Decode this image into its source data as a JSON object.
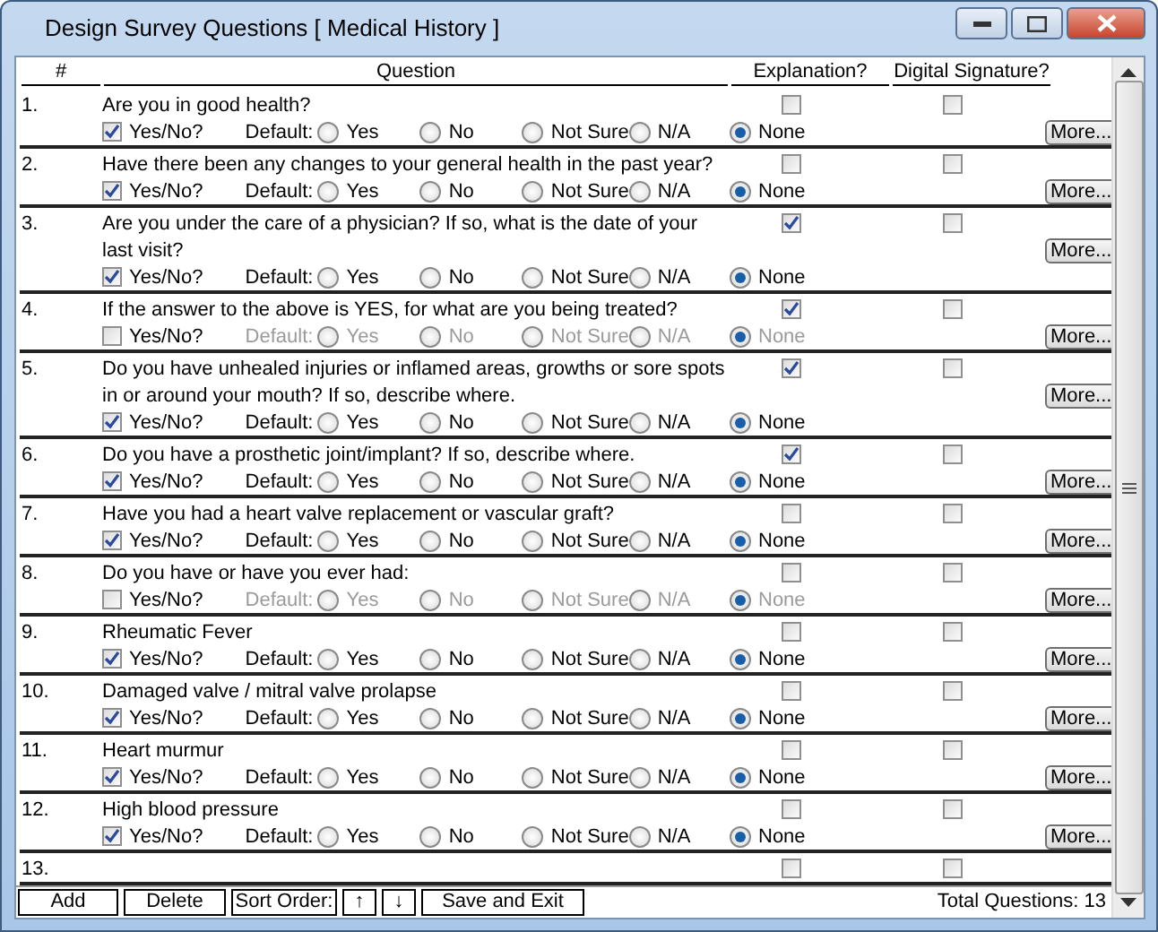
{
  "window": {
    "title": "Design Survey Questions [ Medical History ]"
  },
  "columns": [
    "#",
    "Question",
    "Explanation?",
    "Digital Signature?"
  ],
  "rows": [
    {
      "number": "1.",
      "question_lines": [
        "Are you in good health?"
      ],
      "explanation": false,
      "signature": false,
      "yes_no": {
        "label": "Yes/No?",
        "checked": true
      },
      "default_label": "Default:",
      "options": [
        {
          "label": "Yes",
          "selected": false
        },
        {
          "label": "No",
          "selected": false
        },
        {
          "label": "Not Sure",
          "selected": false
        },
        {
          "label": "N/A",
          "selected": false
        },
        {
          "label": "None",
          "selected": true
        }
      ],
      "more": "More..."
    },
    {
      "number": "2.",
      "question_lines": [
        "Have there been any changes to your general health in the past year?"
      ],
      "explanation": false,
      "signature": false,
      "yes_no": {
        "label": "Yes/No?",
        "checked": true
      },
      "default_label": "Default:",
      "options": [
        {
          "label": "Yes",
          "selected": false
        },
        {
          "label": "No",
          "selected": false
        },
        {
          "label": "Not Sure",
          "selected": false
        },
        {
          "label": "N/A",
          "selected": false
        },
        {
          "label": "None",
          "selected": true
        }
      ],
      "more": "More..."
    },
    {
      "number": "3.",
      "question_lines": [
        "Are you under the care of a physician? If so, what is the date of your",
        "last visit?"
      ],
      "explanation": true,
      "signature": false,
      "yes_no": {
        "label": "Yes/No?",
        "checked": true
      },
      "default_label": "Default:",
      "options": [
        {
          "label": "Yes",
          "selected": false
        },
        {
          "label": "No",
          "selected": false
        },
        {
          "label": "Not Sure",
          "selected": false
        },
        {
          "label": "N/A",
          "selected": false
        },
        {
          "label": "None",
          "selected": true
        }
      ],
      "more": "More..."
    },
    {
      "number": "4.",
      "question_lines": [
        "If the answer to the above is YES, for what are you being treated?"
      ],
      "explanation": true,
      "signature": false,
      "yes_no": {
        "label": "Yes/No?",
        "checked": false
      },
      "default_label": "Default:",
      "options": [
        {
          "label": "Yes",
          "selected": false
        },
        {
          "label": "No",
          "selected": false
        },
        {
          "label": "Not Sure",
          "selected": false
        },
        {
          "label": "N/A",
          "selected": false
        },
        {
          "label": "None",
          "selected": true
        }
      ],
      "more": "More..."
    },
    {
      "number": "5.",
      "question_lines": [
        "Do you have unhealed injuries or inflamed areas, growths or sore spots",
        "in or around your mouth? If so, describe where."
      ],
      "explanation": true,
      "signature": false,
      "yes_no": {
        "label": "Yes/No?",
        "checked": true
      },
      "default_label": "Default:",
      "options": [
        {
          "label": "Yes",
          "selected": false
        },
        {
          "label": "No",
          "selected": false
        },
        {
          "label": "Not Sure",
          "selected": false
        },
        {
          "label": "N/A",
          "selected": false
        },
        {
          "label": "None",
          "selected": true
        }
      ],
      "more": "More..."
    },
    {
      "number": "6.",
      "question_lines": [
        "Do you have a prosthetic joint/implant? If so, describe where."
      ],
      "explanation": true,
      "signature": false,
      "yes_no": {
        "label": "Yes/No?",
        "checked": true
      },
      "default_label": "Default:",
      "options": [
        {
          "label": "Yes",
          "selected": false
        },
        {
          "label": "No",
          "selected": false
        },
        {
          "label": "Not Sure",
          "selected": false
        },
        {
          "label": "N/A",
          "selected": false
        },
        {
          "label": "None",
          "selected": true
        }
      ],
      "more": "More..."
    },
    {
      "number": "7.",
      "question_lines": [
        "Have you had a heart valve replacement or vascular graft?"
      ],
      "explanation": false,
      "signature": false,
      "yes_no": {
        "label": "Yes/No?",
        "checked": true
      },
      "default_label": "Default:",
      "options": [
        {
          "label": "Yes",
          "selected": false
        },
        {
          "label": "No",
          "selected": false
        },
        {
          "label": "Not Sure",
          "selected": false
        },
        {
          "label": "N/A",
          "selected": false
        },
        {
          "label": "None",
          "selected": true
        }
      ],
      "more": "More..."
    },
    {
      "number": "8.",
      "question_lines": [
        "Do you have or have you ever had:"
      ],
      "explanation": false,
      "signature": false,
      "yes_no": {
        "label": "Yes/No?",
        "checked": false
      },
      "default_label": "Default:",
      "options": [
        {
          "label": "Yes",
          "selected": false
        },
        {
          "label": "No",
          "selected": false
        },
        {
          "label": "Not Sure",
          "selected": false
        },
        {
          "label": "N/A",
          "selected": false
        },
        {
          "label": "None",
          "selected": true
        }
      ],
      "more": "More..."
    },
    {
      "number": "9.",
      "question_lines": [
        "Rheumatic Fever"
      ],
      "explanation": false,
      "signature": false,
      "yes_no": {
        "label": "Yes/No?",
        "checked": true
      },
      "default_label": "Default:",
      "options": [
        {
          "label": "Yes",
          "selected": false
        },
        {
          "label": "No",
          "selected": false
        },
        {
          "label": "Not Sure",
          "selected": false
        },
        {
          "label": "N/A",
          "selected": false
        },
        {
          "label": "None",
          "selected": true
        }
      ],
      "more": "More..."
    },
    {
      "number": "10.",
      "question_lines": [
        "Damaged valve / mitral valve prolapse"
      ],
      "explanation": false,
      "signature": false,
      "yes_no": {
        "label": "Yes/No?",
        "checked": true
      },
      "default_label": "Default:",
      "options": [
        {
          "label": "Yes",
          "selected": false
        },
        {
          "label": "No",
          "selected": false
        },
        {
          "label": "Not Sure",
          "selected": false
        },
        {
          "label": "N/A",
          "selected": false
        },
        {
          "label": "None",
          "selected": true
        }
      ],
      "more": "More..."
    },
    {
      "number": "11.",
      "question_lines": [
        "Heart murmur"
      ],
      "explanation": false,
      "signature": false,
      "yes_no": {
        "label": "Yes/No?",
        "checked": true
      },
      "default_label": "Default:",
      "options": [
        {
          "label": "Yes",
          "selected": false
        },
        {
          "label": "No",
          "selected": false
        },
        {
          "label": "Not Sure",
          "selected": false
        },
        {
          "label": "N/A",
          "selected": false
        },
        {
          "label": "None",
          "selected": true
        }
      ],
      "more": "More..."
    },
    {
      "number": "12.",
      "question_lines": [
        "High blood pressure"
      ],
      "explanation": false,
      "signature": false,
      "yes_no": {
        "label": "Yes/No?",
        "checked": true
      },
      "default_label": "Default:",
      "options": [
        {
          "label": "Yes",
          "selected": false
        },
        {
          "label": "No",
          "selected": false
        },
        {
          "label": "Not Sure",
          "selected": false
        },
        {
          "label": "N/A",
          "selected": false
        },
        {
          "label": "None",
          "selected": true
        }
      ],
      "more": "More..."
    },
    {
      "number": "13.",
      "question_lines": [],
      "explanation": false,
      "signature": false
    }
  ],
  "toolbar": {
    "add": "Add",
    "delete": "Delete",
    "sort_label": "Sort Order:",
    "up": "↑",
    "down": "↓",
    "save": "Save and Exit",
    "total": "Total Questions: 13"
  }
}
